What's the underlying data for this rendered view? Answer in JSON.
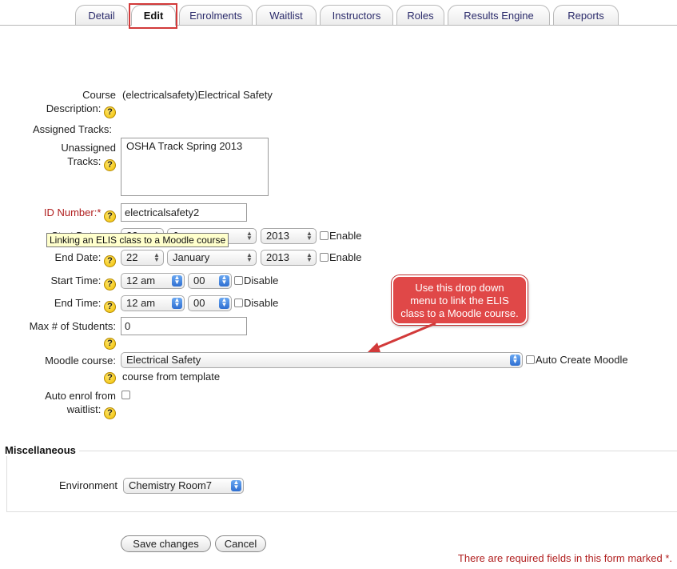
{
  "tabs": [
    {
      "label": "Detail",
      "active": false
    },
    {
      "label": "Edit",
      "active": true
    },
    {
      "label": "Enrolments",
      "active": false
    },
    {
      "label": "Waitlist",
      "active": false
    },
    {
      "label": "Instructors",
      "active": false
    },
    {
      "label": "Roles",
      "active": false
    },
    {
      "label": "Results Engine",
      "active": false
    },
    {
      "label": "Reports",
      "active": false
    }
  ],
  "form": {
    "course": {
      "label": "Course",
      "value": "(electricalsafety)Electrical Safety"
    },
    "description": {
      "label": "Description:"
    },
    "assigned_tracks": {
      "label": "Assigned Tracks:"
    },
    "unassigned_tracks": {
      "label_line1": "Unassigned",
      "label_line2": "Tracks:",
      "options": [
        "OSHA Track Spring 2013"
      ]
    },
    "id_number": {
      "label": "ID Number:",
      "required_mark": "*",
      "value": "electricalsafety2"
    },
    "start_date": {
      "label": "Start Date:",
      "day": "22",
      "month": "January",
      "year": "2013",
      "enable_label": "Enable"
    },
    "end_date": {
      "label": "End Date:",
      "day": "22",
      "month": "January",
      "year": "2013",
      "enable_label": "Enable"
    },
    "start_time": {
      "label": "Start Time:",
      "hour": "12 am",
      "minute": "00",
      "disable_label": "Disable"
    },
    "end_time": {
      "label": "End Time:",
      "hour": "12 am",
      "minute": "00",
      "disable_label": "Disable"
    },
    "max_students": {
      "label": "Max # of Students:",
      "value": "0"
    },
    "moodle_course": {
      "label": "Moodle course:",
      "value": "Electrical Safety",
      "auto_create_label": "Auto Create Moodle",
      "auto_create_label_cont": "course from template"
    },
    "auto_enrol": {
      "label_line1": "Auto enrol from",
      "label_line2": "waitlist:"
    },
    "help_glyph": "?"
  },
  "tooltip": {
    "text": "Linking an ELIS class to a Moodle course"
  },
  "callout": {
    "line1": "Use this drop down",
    "line2": "menu to link the ELIS",
    "line3": "class to a Moodle course."
  },
  "misc": {
    "legend": "Miscellaneous",
    "environment_label": "Environment",
    "environment_value": "Chemistry Room7"
  },
  "buttons": {
    "save": "Save changes",
    "cancel": "Cancel"
  },
  "footer": {
    "required_note": "There are required fields in this form marked",
    "required_mark": "*."
  },
  "colors": {
    "required": "#b01e1e",
    "callout": "#e04848",
    "highlight": "#d23a3a",
    "tooltip_bg": "#ffffcc"
  }
}
